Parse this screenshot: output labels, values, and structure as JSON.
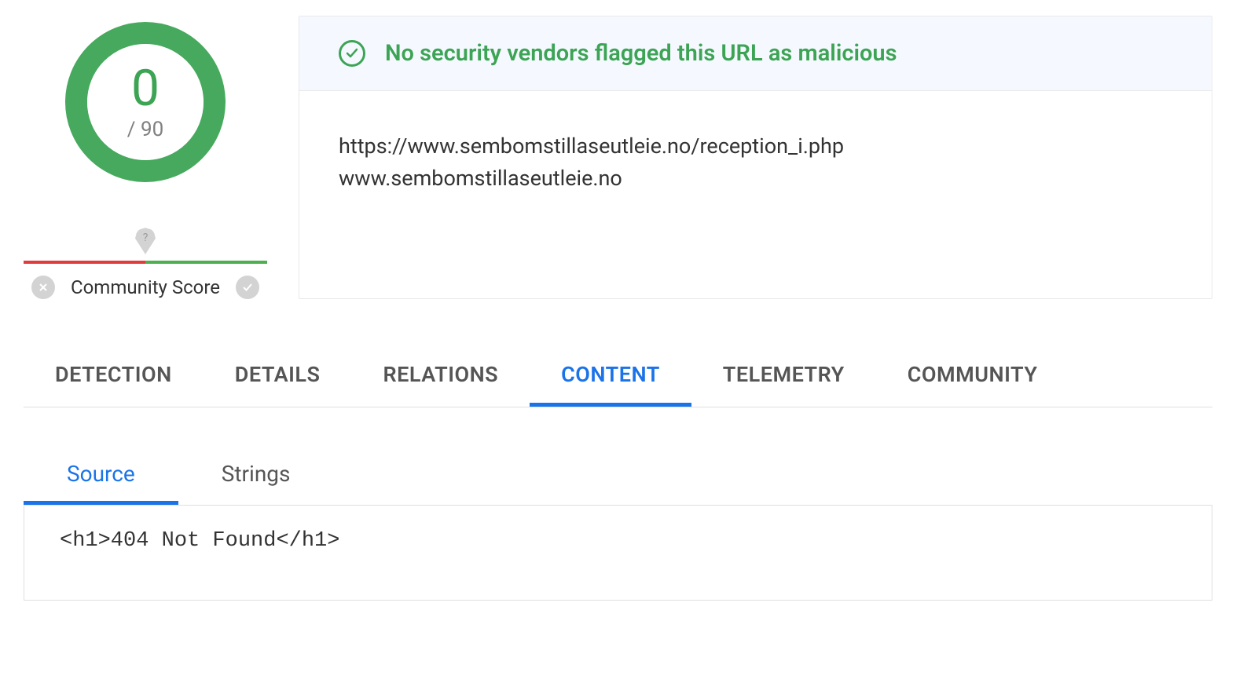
{
  "score": {
    "detections": "0",
    "total": "/ 90"
  },
  "community": {
    "marker": "?",
    "label": "Community Score"
  },
  "verdict": {
    "message": "No security vendors flagged this URL as malicious"
  },
  "url_info": {
    "full_url": "https://www.sembomstillaseutleie.no/reception_i.php",
    "domain": "www.sembomstillaseutleie.no"
  },
  "tabs": [
    {
      "id": "detection",
      "label": "DETECTION",
      "active": false
    },
    {
      "id": "details",
      "label": "DETAILS",
      "active": false
    },
    {
      "id": "relations",
      "label": "RELATIONS",
      "active": false
    },
    {
      "id": "content",
      "label": "CONTENT",
      "active": true
    },
    {
      "id": "telemetry",
      "label": "TELEMETRY",
      "active": false
    },
    {
      "id": "community",
      "label": "COMMUNITY",
      "active": false
    }
  ],
  "subtabs": [
    {
      "id": "source",
      "label": "Source",
      "active": true
    },
    {
      "id": "strings",
      "label": "Strings",
      "active": false
    }
  ],
  "source_content": "<h1>404 Not Found</h1>"
}
